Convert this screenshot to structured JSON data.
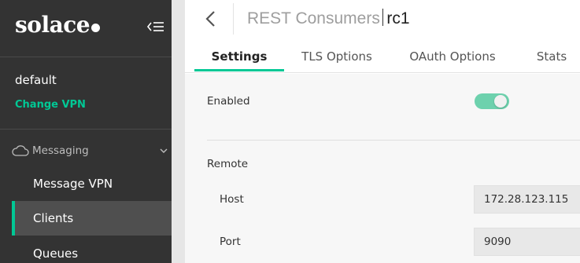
{
  "brand": {
    "name": "solace"
  },
  "sidebar": {
    "vpn_name": "default",
    "change_vpn_label": "Change VPN",
    "section_label": "Messaging",
    "items": [
      {
        "label": "Message VPN"
      },
      {
        "label": "Clients"
      },
      {
        "label": "Queues"
      }
    ],
    "active_item": "Clients"
  },
  "header": {
    "title": "REST Consumers",
    "object_name": "rc1"
  },
  "tabs": [
    {
      "label": "Settings"
    },
    {
      "label": "TLS Options"
    },
    {
      "label": "OAuth Options"
    },
    {
      "label": "Stats"
    }
  ],
  "active_tab": "Settings",
  "settings": {
    "enabled_label": "Enabled",
    "enabled": true,
    "remote_label": "Remote",
    "host_label": "Host",
    "host_value": "172.28.123.115",
    "port_label": "Port",
    "port_value": "9090"
  },
  "colors": {
    "accent": "#00c895",
    "sidebar_bg": "#333333",
    "toggle_on": "#6dd1ad"
  }
}
